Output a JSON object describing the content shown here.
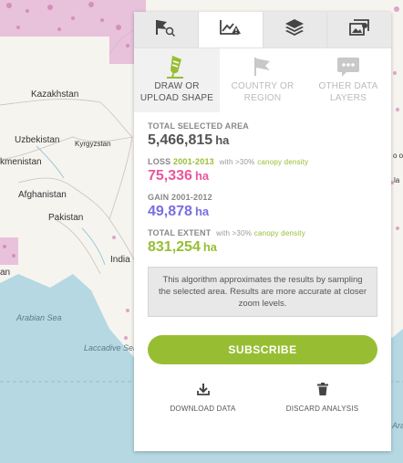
{
  "map": {
    "labels": [
      "Kazakhstan",
      "Uzbekistan",
      "Kyrgyzstan",
      "kmenistan",
      "Afghanistan",
      "Pakistan",
      "India",
      "Arabian Sea",
      "Laccadive Sea",
      "an",
      "Ara",
      "o ol",
      "la"
    ]
  },
  "tabs": [
    {
      "icon": "flag-search-icon"
    },
    {
      "icon": "analysis-chart-icon"
    },
    {
      "icon": "layers-icon"
    },
    {
      "icon": "image-gallery-icon"
    }
  ],
  "subnav": [
    {
      "line1": "DRAW OR",
      "line2": "UPLOAD SHAPE",
      "icon": "draw-shape-icon"
    },
    {
      "line1": "COUNTRY OR",
      "line2": "REGION",
      "icon": "flag-icon"
    },
    {
      "line1": "OTHER DATA",
      "line2": "LAYERS",
      "icon": "comment-icon"
    }
  ],
  "stats": {
    "area": {
      "title": "TOTAL SELECTED AREA",
      "value": "5,466,815",
      "unit": "ha"
    },
    "loss": {
      "title": "LOSS",
      "years": "2001-2013",
      "with": "with >30%",
      "canopy": "canopy density",
      "value": "75,336",
      "unit": "ha"
    },
    "gain": {
      "title": "GAIN 2001-2012",
      "value": "49,878",
      "unit": "ha"
    },
    "extent": {
      "title": "TOTAL EXTENT",
      "with": "with >30%",
      "canopy": "canopy density",
      "value": "831,254",
      "unit": "ha"
    }
  },
  "note": "This algorithm approximates the results by sampling the selected area. Results are more accurate at closer zoom levels.",
  "subscribe_label": "SUBSCRIBE",
  "actions": {
    "download": "DOWNLOAD DATA",
    "discard": "DISCARD ANALYSIS"
  },
  "colors": {
    "accent_green": "#97be32",
    "loss_pink": "#e9569b",
    "gain_purple": "#7a6ee0",
    "extent_green": "#97be32"
  }
}
